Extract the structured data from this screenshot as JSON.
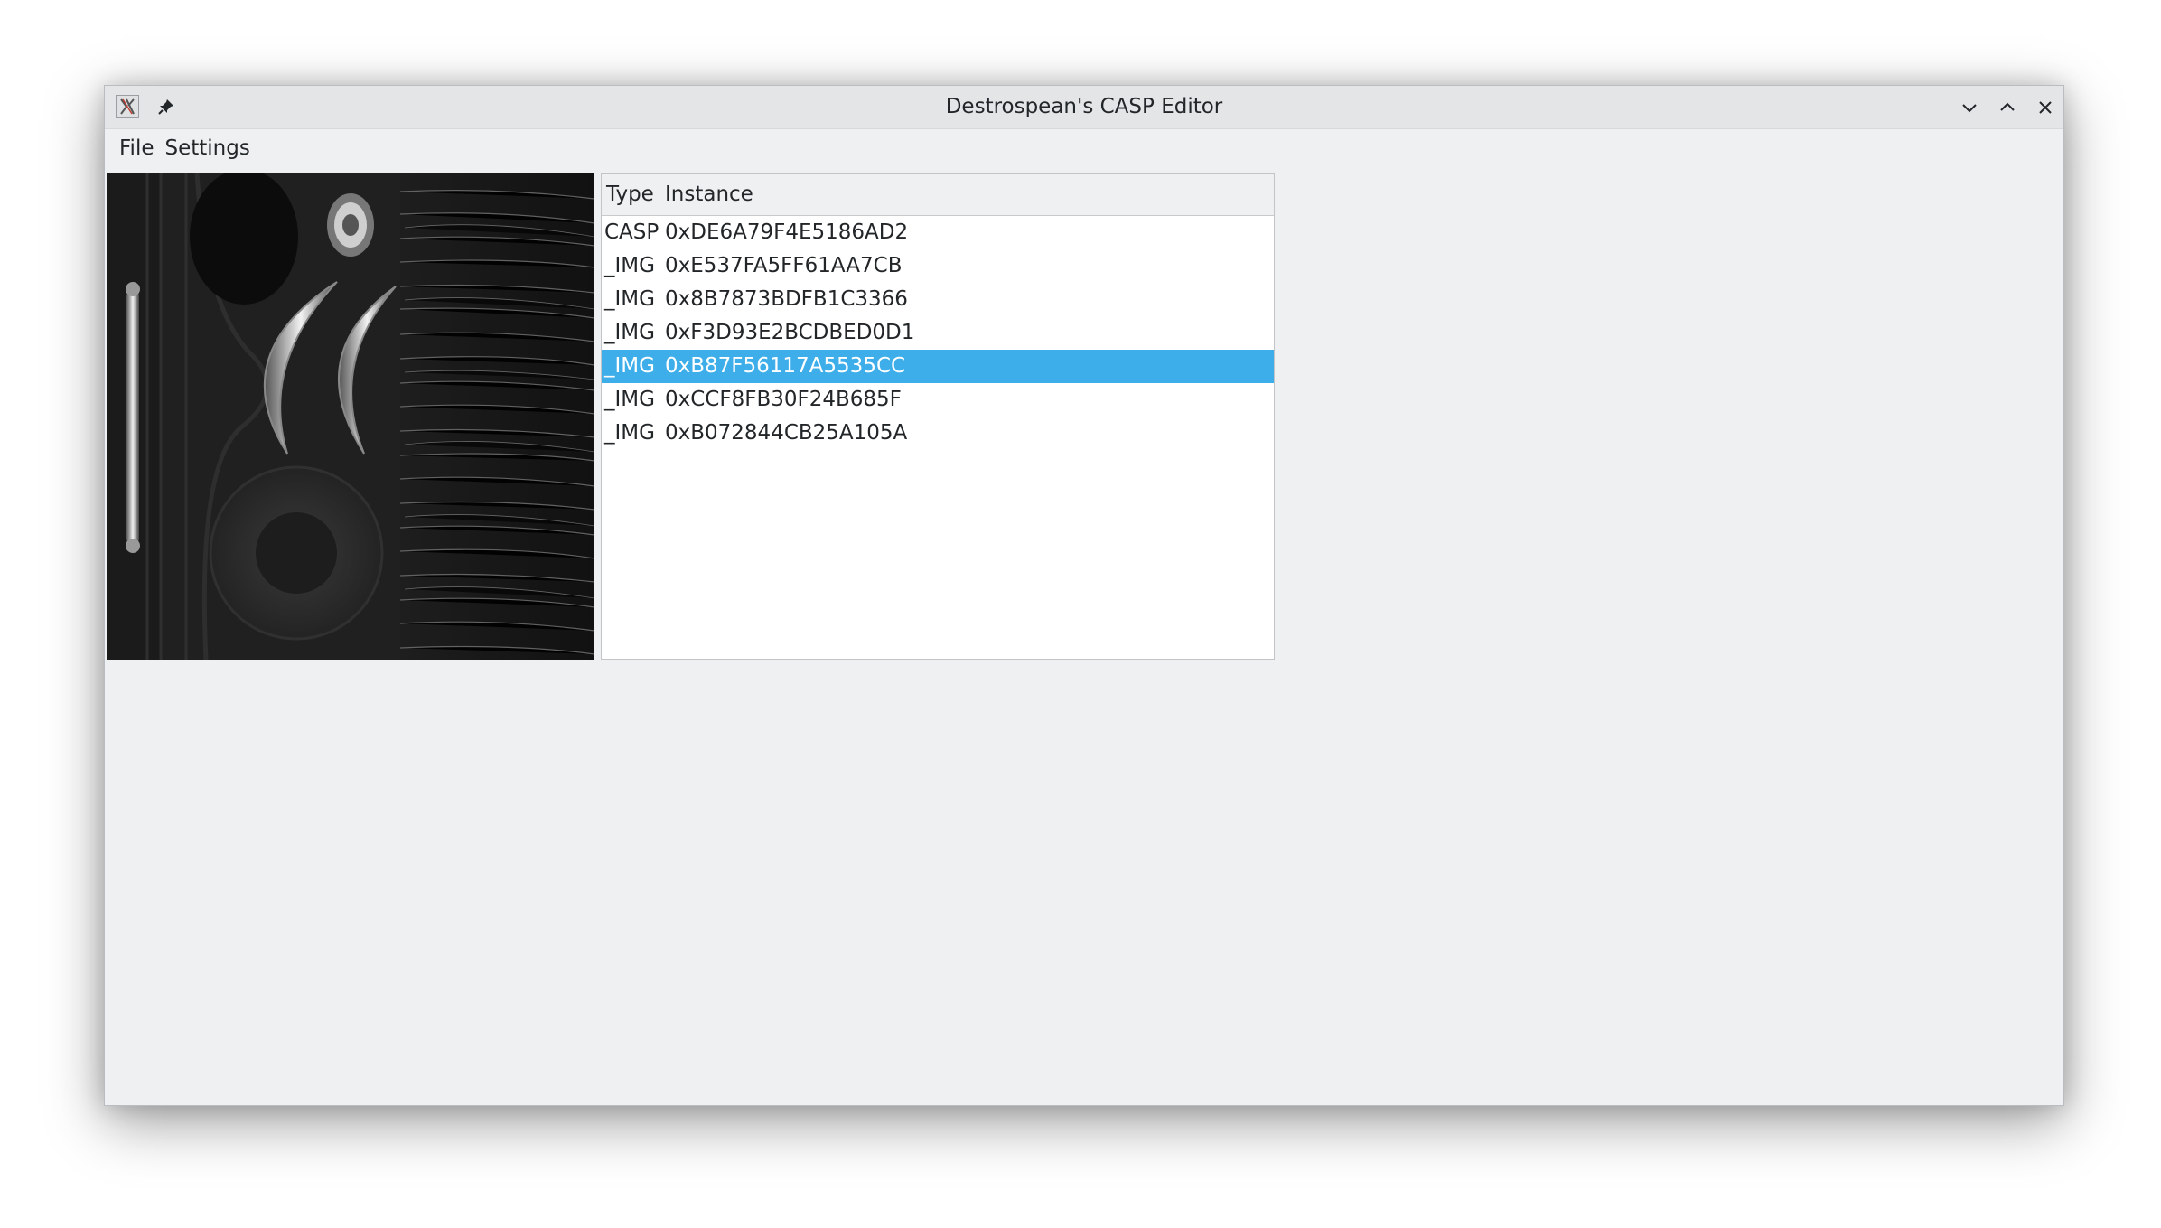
{
  "window": {
    "title": "Destrospean's CASP Editor"
  },
  "menu": {
    "file": "File",
    "settings": "Settings"
  },
  "table": {
    "columns": {
      "type": "Type",
      "instance": "Instance"
    },
    "rows": [
      {
        "type": "CASP",
        "instance": "0xDE6A79F4E5186AD2",
        "selected": false
      },
      {
        "type": "_IMG",
        "instance": "0xE537FA5FF61AA7CB",
        "selected": false
      },
      {
        "type": "_IMG",
        "instance": "0x8B7873BDFB1C3366",
        "selected": false
      },
      {
        "type": "_IMG",
        "instance": "0xF3D93E2BCDBED0D1",
        "selected": false
      },
      {
        "type": "_IMG",
        "instance": "0xB87F56117A5535CC",
        "selected": true
      },
      {
        "type": "_IMG",
        "instance": "0xCCF8FB30F24B685F",
        "selected": false
      },
      {
        "type": "_IMG",
        "instance": "0xB072844CB25A105A",
        "selected": false
      }
    ]
  },
  "colors": {
    "selection": "#3daee9",
    "window_bg": "#eff0f1",
    "titlebar_bg": "#e3e5e7"
  },
  "icons": {
    "app": "x-app-icon",
    "pin": "pin-icon",
    "minimize": "chevron-down-icon",
    "maximize": "chevron-up-icon",
    "close": "close-icon"
  }
}
